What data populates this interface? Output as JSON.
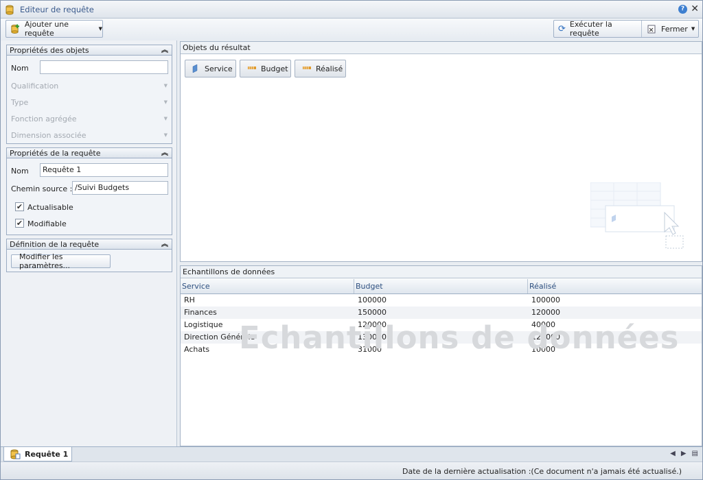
{
  "window": {
    "title": "Editeur de requête"
  },
  "toolbar": {
    "add_query": "Ajouter une requête",
    "run_query": "Exécuter la requête",
    "close": "Fermer"
  },
  "object_props": {
    "title": "Propriétés des objets",
    "name_label": "Nom",
    "name_value": "",
    "qualification": "Qualification",
    "type": "Type",
    "aggregate": "Fonction agrégée",
    "dimension": "Dimension associée"
  },
  "query_props": {
    "title": "Propriétés de la requête",
    "name_label": "Nom",
    "name_value": "Requête 1",
    "source_label": "Chemin source :",
    "source_value": "/Suivi Budgets",
    "refreshable": "Actualisable",
    "editable": "Modifiable"
  },
  "query_def": {
    "title": "Définition de la requête",
    "edit_params": "Modifier les paramètres..."
  },
  "result_objects": {
    "title": "Objets du résultat",
    "items": [
      {
        "label": "Service",
        "kind": "dimension",
        "color": "#5a8fd0"
      },
      {
        "label": "Budget",
        "kind": "measure",
        "color": "#e09a2c"
      },
      {
        "label": "Réalisé",
        "kind": "measure",
        "color": "#e09a2c"
      }
    ]
  },
  "samples": {
    "title": "Echantillons de données",
    "watermark": "Echantillons de données",
    "columns": [
      "Service",
      "Budget",
      "Réalisé"
    ],
    "rows": [
      [
        "RH",
        "100000",
        "100000"
      ],
      [
        "Finances",
        "150000",
        "120000"
      ],
      [
        "Logistique",
        "120000",
        "40000"
      ],
      [
        "Direction Générale",
        "130000",
        "125000"
      ],
      [
        "Achats",
        "31000",
        "10000"
      ]
    ]
  },
  "tabs": {
    "active": "Requête 1"
  },
  "status": {
    "text": "Date de la dernière actualisation :(Ce document n'a jamais été actualisé.)"
  }
}
